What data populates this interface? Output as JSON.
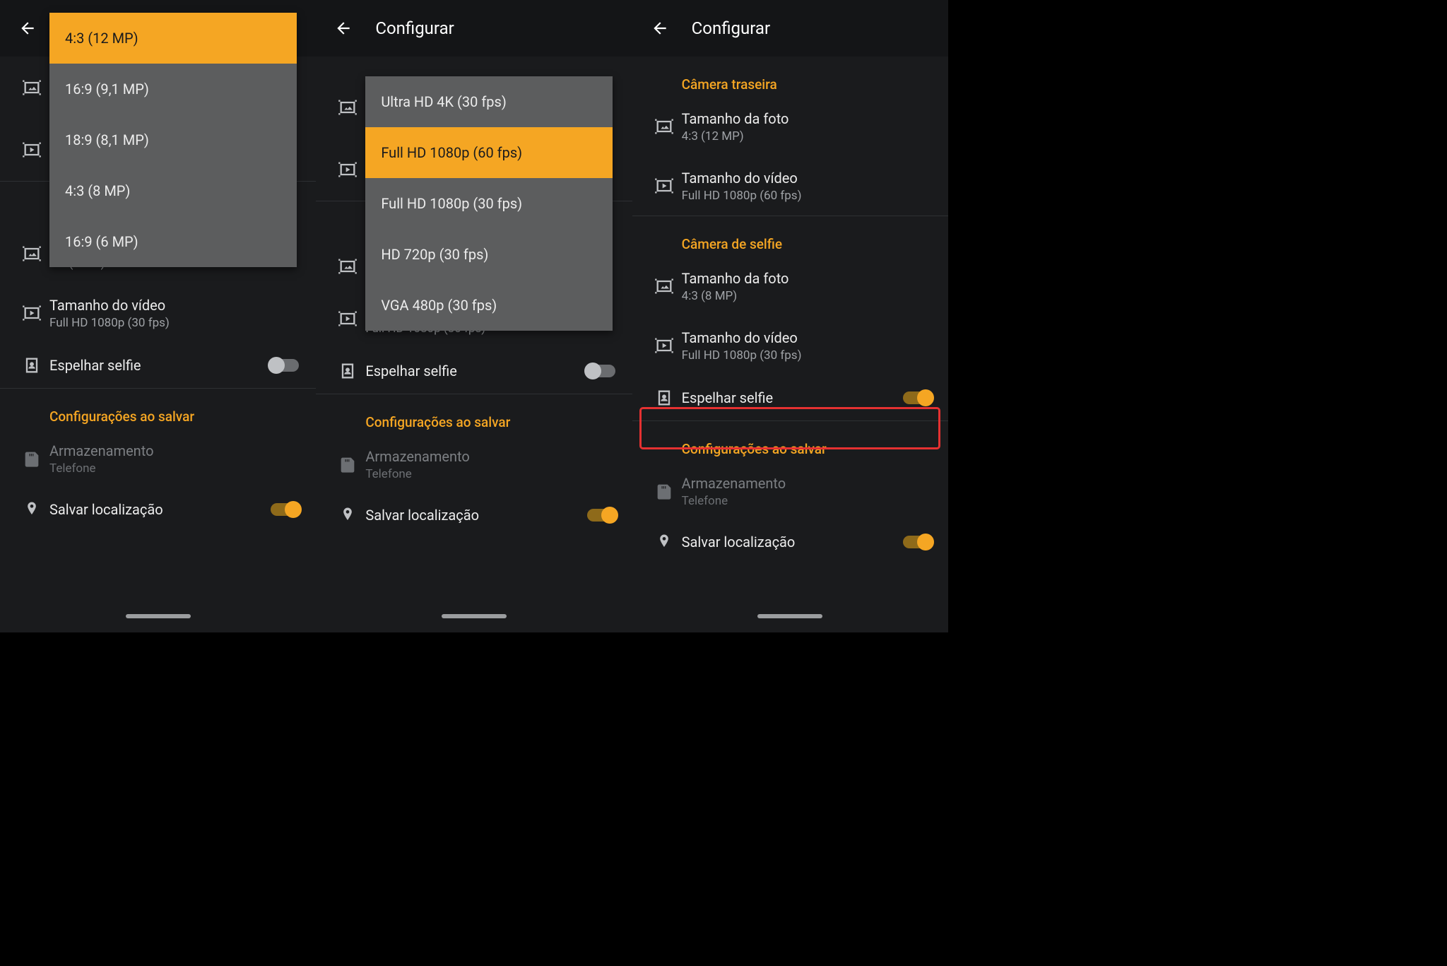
{
  "colors": {
    "accent": "#f5a623",
    "highlight": "#e53131"
  },
  "header": {
    "title": "Configurar"
  },
  "sections": {
    "rear": "Câmera traseira",
    "selfie": "Câmera de selfie",
    "save": "Configurações ao salvar"
  },
  "items": {
    "rear_photo": {
      "label": "Tamanho da foto",
      "value": "4:3 (12 MP)"
    },
    "rear_video": {
      "label": "Tamanho do vídeo",
      "value": "Full HD 1080p (60 fps)"
    },
    "selfie_photo": {
      "label": "Tamanho da foto",
      "value": "4:3 (8 MP)"
    },
    "selfie_video": {
      "label": "Tamanho do vídeo",
      "value": "Full HD 1080p (30 fps)"
    },
    "mirror": {
      "label": "Espelhar selfie"
    },
    "storage": {
      "label": "Armazenamento",
      "value": "Telefone"
    },
    "location": {
      "label": "Salvar localização"
    }
  },
  "photo_size_options": [
    "4:3 (12 MP)",
    "16:9 (9,1 MP)",
    "18:9 (8,1 MP)",
    "4:3 (8 MP)",
    "16:9 (6 MP)"
  ],
  "video_size_options": [
    "Ultra HD 4K (30 fps)",
    "Full HD 1080p (60 fps)",
    "Full HD 1080p (30 fps)",
    "HD 720p (30 fps)",
    "VGA 480p (30 fps)"
  ],
  "panel1_partial": {
    "sub": "4:3 (8 MP)"
  }
}
